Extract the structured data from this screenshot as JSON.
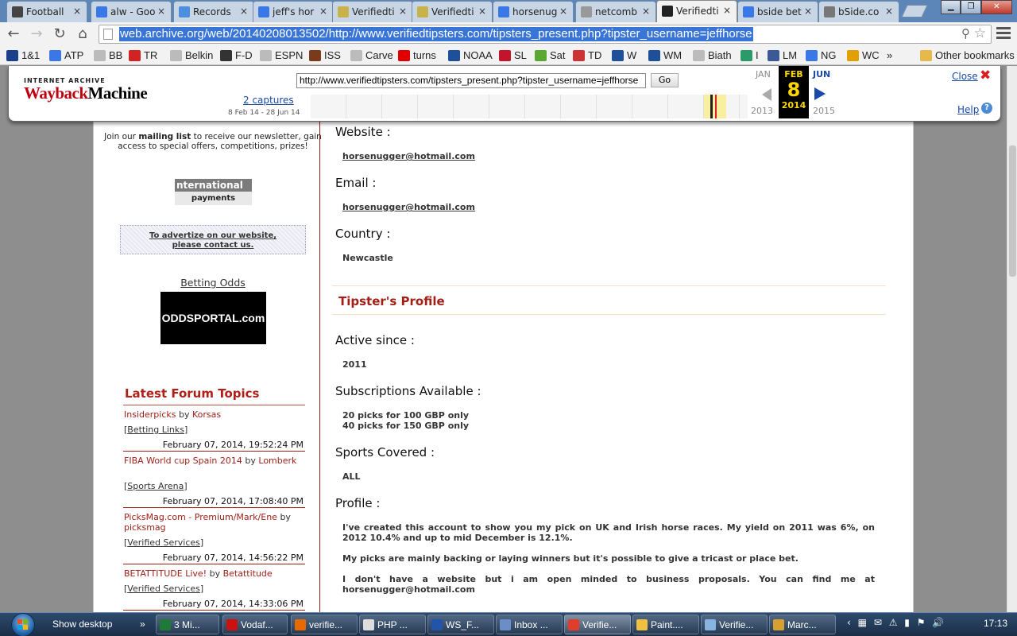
{
  "browser": {
    "tabs": [
      {
        "label": "Football",
        "icon": "soccer-ball-icon",
        "color": "#444444"
      },
      {
        "label": "alw - Goo",
        "icon": "google-icon",
        "color": "#3b78e7"
      },
      {
        "label": "Records",
        "icon": "records-icon",
        "color": "#4d8ee0"
      },
      {
        "label": "jeff's hor",
        "icon": "google-icon",
        "color": "#3b78e7"
      },
      {
        "label": "Verifiedti",
        "icon": "vt-icon",
        "color": "#c7b34a"
      },
      {
        "label": "Verifiedti",
        "icon": "vt-icon",
        "color": "#c7b34a"
      },
      {
        "label": "horsenug",
        "icon": "google-icon",
        "color": "#3b78e7"
      },
      {
        "label": "netcomb",
        "icon": "page-icon",
        "color": "#999999"
      },
      {
        "label": "Verifiedti",
        "icon": "archive-icon",
        "color": "#222222",
        "active": true
      },
      {
        "label": "bside bet",
        "icon": "google-icon",
        "color": "#3b78e7"
      },
      {
        "label": "bSide.co",
        "icon": "gear-icon",
        "color": "#777777"
      }
    ],
    "url": "web.archive.org/web/20140208013502/http://www.verifiedtipsters.com/tipsters_present.php?tipster_username=jeffhorse",
    "bookmarks": [
      {
        "label": "1&1",
        "icon": "bookmark-1and1-icon",
        "color": "#1b3f8b"
      },
      {
        "label": "ATP",
        "icon": "bookmark-atp-icon",
        "color": "#3b78e7"
      },
      {
        "label": "BB",
        "icon": "page-icon",
        "color": "#bbbbbb"
      },
      {
        "label": "TR",
        "icon": "bookmark-tr-icon",
        "color": "#d22222"
      },
      {
        "label": "Belkin",
        "icon": "page-icon",
        "color": "#bbbbbb"
      },
      {
        "label": "F-D",
        "icon": "soccer-ball-icon",
        "color": "#333333"
      },
      {
        "label": "ESPN",
        "icon": "page-icon",
        "color": "#bbbbbb"
      },
      {
        "label": "ISS",
        "icon": "bookmark-iss-icon",
        "color": "#7a3b1d"
      },
      {
        "label": "Carve",
        "icon": "page-icon",
        "color": "#bbbbbb"
      },
      {
        "label": "turns",
        "icon": "youtube-icon",
        "color": "#e00000"
      },
      {
        "label": "NOAA",
        "icon": "noaa-icon",
        "color": "#1d4f9a"
      },
      {
        "label": "SL",
        "icon": "bookmark-sl-icon",
        "color": "#c2142b"
      },
      {
        "label": "Sat",
        "icon": "bookmark-sat-icon",
        "color": "#5aa832"
      },
      {
        "label": "TD",
        "icon": "bookmark-td-icon",
        "color": "#cc3333"
      },
      {
        "label": "W",
        "icon": "bookmark-w-icon",
        "color": "#1d4f9a"
      },
      {
        "label": "WM",
        "icon": "bookmark-wm-icon",
        "color": "#1d4f9a"
      },
      {
        "label": "Biath",
        "icon": "page-icon",
        "color": "#bbbbbb"
      },
      {
        "label": "I",
        "icon": "bookmark-i-icon",
        "color": "#2a9a6a"
      },
      {
        "label": "LM",
        "icon": "facebook-icon",
        "color": "#3b5998"
      },
      {
        "label": "NG",
        "icon": "google-icon",
        "color": "#3b78e7"
      },
      {
        "label": "WC",
        "icon": "bookmark-wc-icon",
        "color": "#e2a000"
      }
    ],
    "bookmarks_more": "»",
    "other_bookmarks": "Other bookmarks"
  },
  "wayback": {
    "logo_top": "INTERNET ARCHIVE",
    "logo_main_1": "Wayback",
    "logo_main_2": "Machine",
    "url_input": "http://www.verifiedtipsters.com/tipsters_present.php?tipster_username=jeffhorse",
    "go_label": "Go",
    "captures": "2 captures",
    "range": "8 Feb 14 - 28 Jun 14",
    "prev_month": "JAN",
    "current_month": "FEB",
    "current_day": "8",
    "current_year": "2014",
    "next_month": "JUN",
    "prev_year": "2013",
    "next_year": "2015",
    "close_label": "Close",
    "help_label": "Help"
  },
  "sidebar": {
    "mailing_pre": "Join our ",
    "mailing_bold": "mailing list",
    "mailing_post": " to receive our newsletter, gain access to special offers, competitions, prizes!",
    "intl_top": "nternational",
    "intl_bottom": "payments",
    "advert_line1": "To advertize on our website,",
    "advert_line2": "please contact us.",
    "betting_odds": "Betting Odds",
    "oddsportal": "ODDSPORTAL.com",
    "forum_title": "Latest Forum Topics",
    "topics": [
      {
        "title": "Insiderpicks",
        "by": "by",
        "user": "Korsas",
        "category": "Betting Links",
        "date": "February 07, 2014, 19:52:24 PM"
      },
      {
        "title": "FIBA World cup Spain 2014",
        "by": "by",
        "user": "Lomberk",
        "category": "Sports Arena",
        "date": "February 07, 2014, 17:08:40 PM"
      },
      {
        "title": "PicksMag.com - Premium/Mark/Ene",
        "by": "by",
        "user": "picksmag",
        "category": "Verified Services",
        "date": "February 07, 2014, 14:56:22 PM"
      },
      {
        "title": "BETATTITUDE Live!",
        "by": "by",
        "user": "Betattitude",
        "category": "Verified Services",
        "date": "February 07, 2014, 14:33:06 PM"
      }
    ]
  },
  "profile": {
    "website_label": "Website :",
    "website_value": "horsenugger@hotmail.com",
    "email_label": "Email :",
    "email_value": "horsenugger@hotmail.com",
    "country_label": "Country :",
    "country_value": "Newcastle",
    "section_title": "Tipster's Profile",
    "active_label": "Active since :",
    "active_value": "2011",
    "subs_label": "Subscriptions Available :",
    "subs_line1": "20 picks for 100 GBP only",
    "subs_line2": "40 picks for 150 GBP only",
    "sports_label": "Sports Covered :",
    "sports_value": "ALL",
    "profile_label": "Profile :",
    "para1": "I've created this account to show you my pick on UK and Irish horse races. My yield on 2011 was 6%, on 2012 10.4% and up to mid December is 12.1%.",
    "para2": "My picks are mainly backing or laying winners but it's possible to give a tricast or place bet.",
    "para3": "I don't have a website but i am open minded to business proposals. You can find me at horsenugger@hotmail.com"
  },
  "taskbar": {
    "show_desktop": "Show desktop",
    "chevron": "»",
    "items": [
      {
        "label": "3 Mi...",
        "icon": "excel-icon",
        "color": "#1f7a3a"
      },
      {
        "label": "Vodaf...",
        "icon": "opera-icon",
        "color": "#cc1111"
      },
      {
        "label": "verifie...",
        "icon": "firefox-icon",
        "color": "#e66a00"
      },
      {
        "label": "PHP ...",
        "icon": "editor-icon",
        "color": "#dddddd"
      },
      {
        "label": "WS_F...",
        "icon": "ftp-icon",
        "color": "#2255aa"
      },
      {
        "label": "Inbox ...",
        "icon": "mail-icon",
        "color": "#6b8ec9"
      },
      {
        "label": "Verifie...",
        "icon": "chrome-icon",
        "color": "#e23c2c",
        "active": true
      },
      {
        "label": "Paint....",
        "icon": "paint-icon",
        "color": "#f0c040"
      },
      {
        "label": "Verifie...",
        "icon": "notepad-icon",
        "color": "#88b4e0"
      },
      {
        "label": "Marc...",
        "icon": "document-icon",
        "color": "#d8a030"
      }
    ],
    "clock": "17:13"
  }
}
